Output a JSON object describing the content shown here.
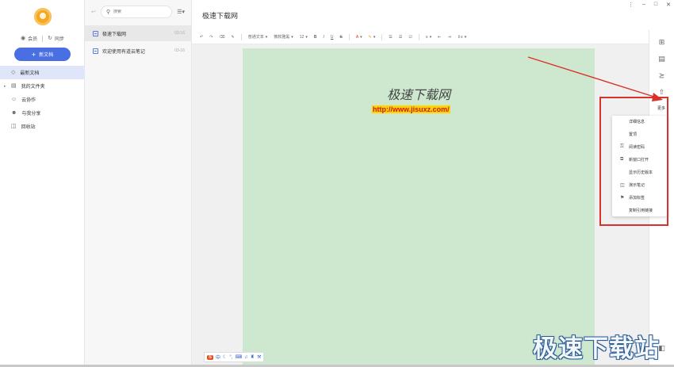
{
  "sidebar": {
    "member_label": "会员",
    "sync_label": "同步",
    "new_doc_label": "新文档",
    "nav": [
      {
        "label": "最新文档",
        "icon": "recent-icon"
      },
      {
        "label": "我的文件夹",
        "icon": "folder-icon"
      },
      {
        "label": "云协作",
        "icon": "collab-icon"
      },
      {
        "label": "与我分享",
        "icon": "share-with-me-icon"
      },
      {
        "label": "回收站",
        "icon": "trash-icon"
      }
    ]
  },
  "notelist": {
    "search_placeholder": "搜索",
    "notes": [
      {
        "title": "极速下载网",
        "date": "03-16"
      },
      {
        "title": "欢迎使用有道云笔记",
        "date": "03-16"
      }
    ]
  },
  "editor": {
    "doc_title": "极速下载网",
    "toolbar": {
      "paragraph_style": "普通文本",
      "font_family": "微软雅黑",
      "font_size": "12"
    },
    "page_heading": "极速下载网",
    "page_link": "http://www.jisuxz.com/"
  },
  "right_rail": {
    "more_label": "更多"
  },
  "dropdown": {
    "items": [
      {
        "label": "详细信息",
        "icon": ""
      },
      {
        "label": "置顶",
        "icon": ""
      },
      {
        "label": "阅读密码",
        "icon": "lock-icon"
      },
      {
        "label": "新窗口打开",
        "icon": "new-window-icon"
      },
      {
        "label": "显示历史版本",
        "icon": ""
      },
      {
        "label": "演示笔记",
        "icon": "presentation-icon"
      },
      {
        "label": "添加标签",
        "icon": "tag-icon"
      },
      {
        "label": "复制引用链接",
        "icon": ""
      }
    ]
  },
  "watermark_text": "极速下载站",
  "colors": {
    "accent": "#4a6fe3",
    "page_background": "#cde8cf",
    "annotation_red": "#d9322d",
    "link_highlight": "#ffd400"
  }
}
